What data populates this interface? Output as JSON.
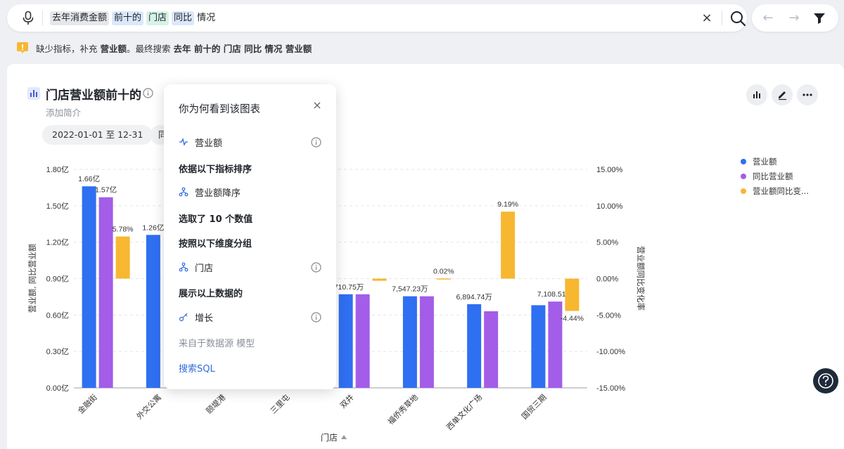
{
  "search": {
    "tokens": [
      {
        "text": "去年消费金额",
        "style": "grey"
      },
      {
        "text": "前十的",
        "style": "blue"
      },
      {
        "text": "门店",
        "style": "green"
      },
      {
        "text": "同比",
        "style": "blue"
      },
      {
        "text": "情况",
        "style": "plain"
      }
    ]
  },
  "notice": {
    "prefix": "缺少指标，补充",
    "added": "营业额",
    "middle": "。最终搜索",
    "final_query": "去年 前十的 门店 同比 情况 营业额"
  },
  "card": {
    "title": "门店营业额前十的",
    "subtitle": "添加简介",
    "date_chip": "2022-01-01 至 12-31",
    "second_chip": "同"
  },
  "chart_data": {
    "type": "bar",
    "xlabel": "门店",
    "ylabel_left": "营业额, 同比营业额",
    "ylabel_right": "营业额同比变化率",
    "ylim_left": [
      0,
      1.8
    ],
    "ylim_right": [
      -15,
      15
    ],
    "left_ticks": [
      "0.00亿",
      "0.30亿",
      "0.60亿",
      "0.90亿",
      "1.20亿",
      "1.50亿",
      "1.80亿"
    ],
    "right_ticks": [
      "-15.00%",
      "-10.00%",
      "-5.00%",
      "0.00%",
      "5.00%",
      "10.00%",
      "15.00%"
    ],
    "categories": [
      "金融街",
      "外交公寓",
      "颐堤港",
      "三里屯",
      "双井",
      "福侨秀草地",
      "西单文化广场",
      "国贸三期"
    ],
    "series": [
      {
        "name": "营业额",
        "color": "#2f6ff1",
        "axis": "left",
        "values": [
          1.66,
          1.26,
          null,
          null,
          0.7711,
          0.7547,
          0.6895,
          0.6809
        ],
        "labels": [
          "1.66亿",
          "1.26亿",
          "",
          "",
          "7,710.75万",
          "7,547.23万",
          "6,894.74万",
          ""
        ]
      },
      {
        "name": "同比营业额",
        "color": "#a35de8",
        "axis": "left",
        "values": [
          1.57,
          null,
          null,
          null,
          0.7712,
          0.7545,
          0.631,
          0.7109
        ],
        "labels": [
          "1.57亿",
          "",
          "",
          "",
          "",
          "",
          "",
          "7,108.51万"
        ]
      },
      {
        "name": "营业额同比变...",
        "color": "#f7b731",
        "axis": "right",
        "values": [
          5.78,
          null,
          null,
          null,
          -0.3,
          0.02,
          9.19,
          -4.44
        ],
        "labels": [
          "5.78%",
          "",
          "",
          "",
          "",
          "0.02%",
          "9.19%",
          "-4.44%"
        ]
      }
    ],
    "legend_position": "right",
    "grid": true
  },
  "popover": {
    "title": "你为何看到该图表",
    "metric": "营业额",
    "sort_heading": "依据以下指标排序",
    "sort_item": "营业额降序",
    "selected_text": "选取了 10 个数值",
    "group_heading": "按照以下维度分组",
    "group_item": "门店",
    "show_heading": "展示以上数据的",
    "show_item": "增长",
    "source_text": "来自于数据源 模型",
    "sql_link": "搜索SQL"
  }
}
